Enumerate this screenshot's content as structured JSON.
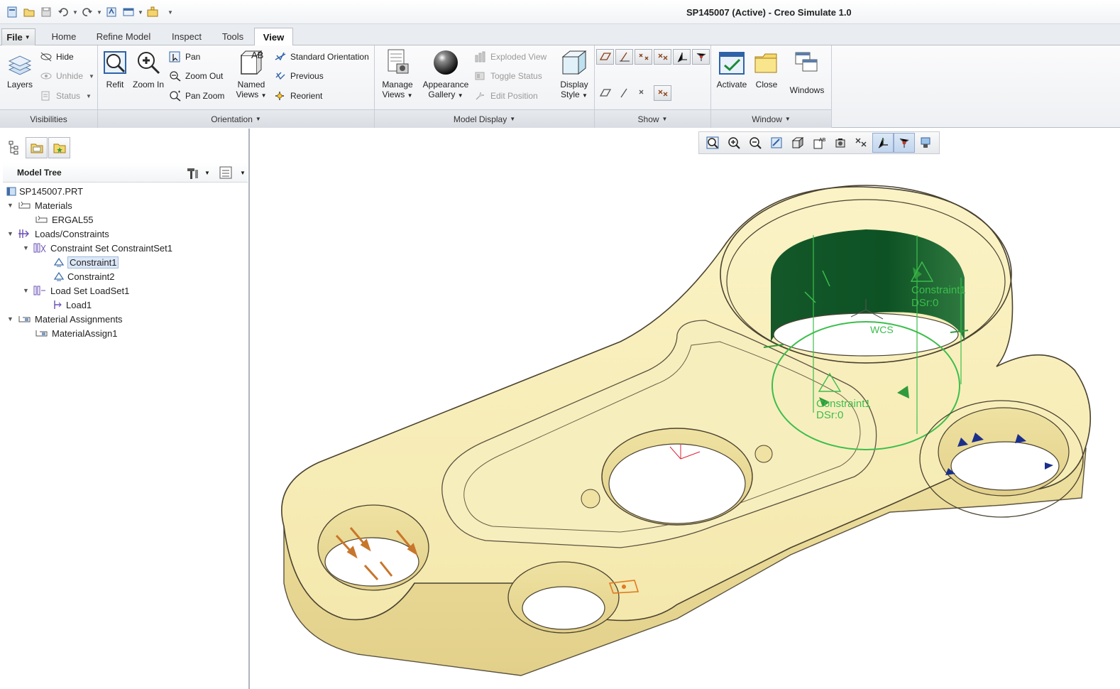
{
  "title": "SP145007 (Active) - Creo Simulate 1.0",
  "quick_access": [
    "new-icon",
    "open-icon",
    "save-icon",
    "undo-icon",
    "redo-icon",
    "regenerate-icon",
    "windows-icon",
    "close-window-icon",
    "customize-icon"
  ],
  "tabs": {
    "file": "File",
    "items": [
      "Home",
      "Refine Model",
      "Inspect",
      "Tools",
      "View"
    ],
    "active": "View"
  },
  "ribbon": {
    "visibilities": {
      "layers": "Layers",
      "hide": "Hide",
      "unhide": "Unhide",
      "status": "Status",
      "group": "Visibilities"
    },
    "orientation": {
      "refit": "Refit",
      "zoom_in": "Zoom In",
      "pan": "Pan",
      "zoom_out": "Zoom Out",
      "pan_zoom": "Pan Zoom",
      "named_views_1": "Named",
      "named_views_2": "Views",
      "standard_orientation": "Standard Orientation",
      "previous": "Previous",
      "reorient": "Reorient",
      "group": "Orientation"
    },
    "model_display": {
      "manage_views_1": "Manage",
      "manage_views_2": "Views",
      "appearance_1": "Appearance",
      "appearance_2": "Gallery",
      "exploded_view": "Exploded View",
      "toggle_status": "Toggle Status",
      "edit_position": "Edit Position",
      "display_style_1": "Display",
      "display_style_2": "Style",
      "group": "Model Display"
    },
    "show": {
      "group": "Show"
    },
    "window": {
      "activate": "Activate",
      "close": "Close",
      "windows": "Windows",
      "group": "Window"
    }
  },
  "model_tree": {
    "header": "Model Tree",
    "items": [
      {
        "label": "SP145007.PRT"
      },
      {
        "label": "Materials"
      },
      {
        "label": "ERGAL55"
      },
      {
        "label": "Loads/Constraints"
      },
      {
        "label": "Constraint Set ConstraintSet1"
      },
      {
        "label": "Constraint1",
        "selected": true
      },
      {
        "label": "Constraint2"
      },
      {
        "label": "Load Set LoadSet1"
      },
      {
        "label": "Load1"
      },
      {
        "label": "Material Assignments"
      },
      {
        "label": "MaterialAssign1"
      }
    ]
  },
  "viewport": {
    "constraint_label_1": "Constraint1",
    "constraint_label_1b": "DSr:0",
    "constraint_label_2": "Constraint1",
    "constraint_label_2b": "DSr:0",
    "csys_label": "WCS"
  },
  "colors": {
    "part": "#f6ecb4",
    "part_shade": "#e9da95",
    "constraint_green": "#0f6a2a",
    "constraint_line": "#3cbe4b",
    "load_arrow": "#c8762b",
    "ribbon_bg": "#eef0f3"
  }
}
